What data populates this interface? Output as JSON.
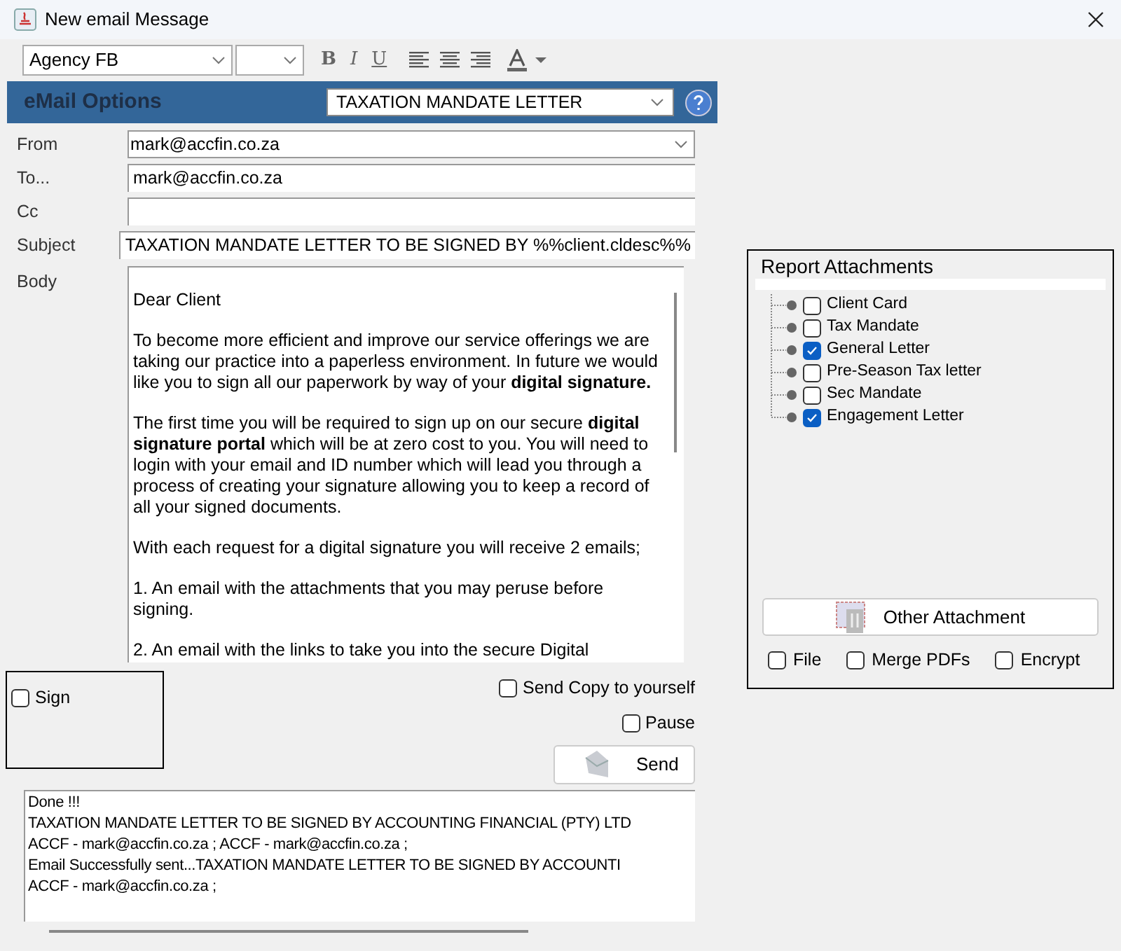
{
  "window": {
    "title": "New email Message"
  },
  "toolbar": {
    "font": "Agency FB",
    "format_buttons": [
      "B",
      "I",
      "U"
    ]
  },
  "options_bar": {
    "title": "eMail Options",
    "template": "TAXATION MANDATE LETTER"
  },
  "fields": [
    {
      "label": "From",
      "value": "mark@accfin.co.za",
      "kind": "dropdown"
    },
    {
      "label": "To...",
      "value": "mark@accfin.co.za",
      "kind": "text"
    },
    {
      "label": "Cc",
      "kind": "text"
    },
    {
      "label": "Subject",
      "value": "TAXATION MANDATE LETTER TO BE SIGNED BY %%client.cldesc%%",
      "kind": "text"
    }
  ],
  "body": {
    "label": "Body",
    "paragraphs": [
      "Dear Client",
      "To become more efficient and improve our service offerings we are taking our practice into a paperless environment. In future we would like you to sign all our paperwork by way of your **digital signature.**",
      "The first time you will be required to sign up on our secure **digital signature portal** which will be at zero cost to you. You will need to login with your email and ID number which will lead you through a process of creating your signature allowing you to keep a record of all your signed documents.",
      "With each request for a digital signature you will receive 2 emails;",
      "1. An email with the attachments that you may peruse before signing.",
      "2. An email with the links to take you into the secure Digital"
    ]
  },
  "sign": {
    "label": "Sign",
    "checked": false
  },
  "send_options": [
    {
      "label": "Send Copy to yourself",
      "checked": false
    },
    {
      "label": "Pause",
      "checked": false
    }
  ],
  "send_button": "Send",
  "log": [
    "Done !!!",
    "TAXATION MANDATE LETTER TO BE SIGNED BY ACCOUNTING FINANCIAL (PTY) LTD",
    "ACCF - mark@accfin.co.za ; ACCF - mark@accfin.co.za ;",
    "Email Successfully sent...TAXATION MANDATE LETTER TO BE SIGNED BY ACCOUNTI",
    "ACCF - mark@accfin.co.za ;"
  ],
  "attachments": {
    "title": "Report Attachments",
    "items": [
      {
        "label": "Client Card",
        "checked": false
      },
      {
        "label": "Tax Mandate",
        "checked": false
      },
      {
        "label": "General Letter",
        "checked": true
      },
      {
        "label": "Pre-Season Tax letter",
        "checked": false
      },
      {
        "label": "Sec Mandate",
        "checked": false
      },
      {
        "label": "Engagement Letter",
        "checked": true
      }
    ],
    "other_button": "Other Attachment",
    "options": [
      {
        "label": "File",
        "checked": false
      },
      {
        "label": "Merge PDFs",
        "checked": false
      },
      {
        "label": "Encrypt",
        "checked": false
      }
    ]
  }
}
